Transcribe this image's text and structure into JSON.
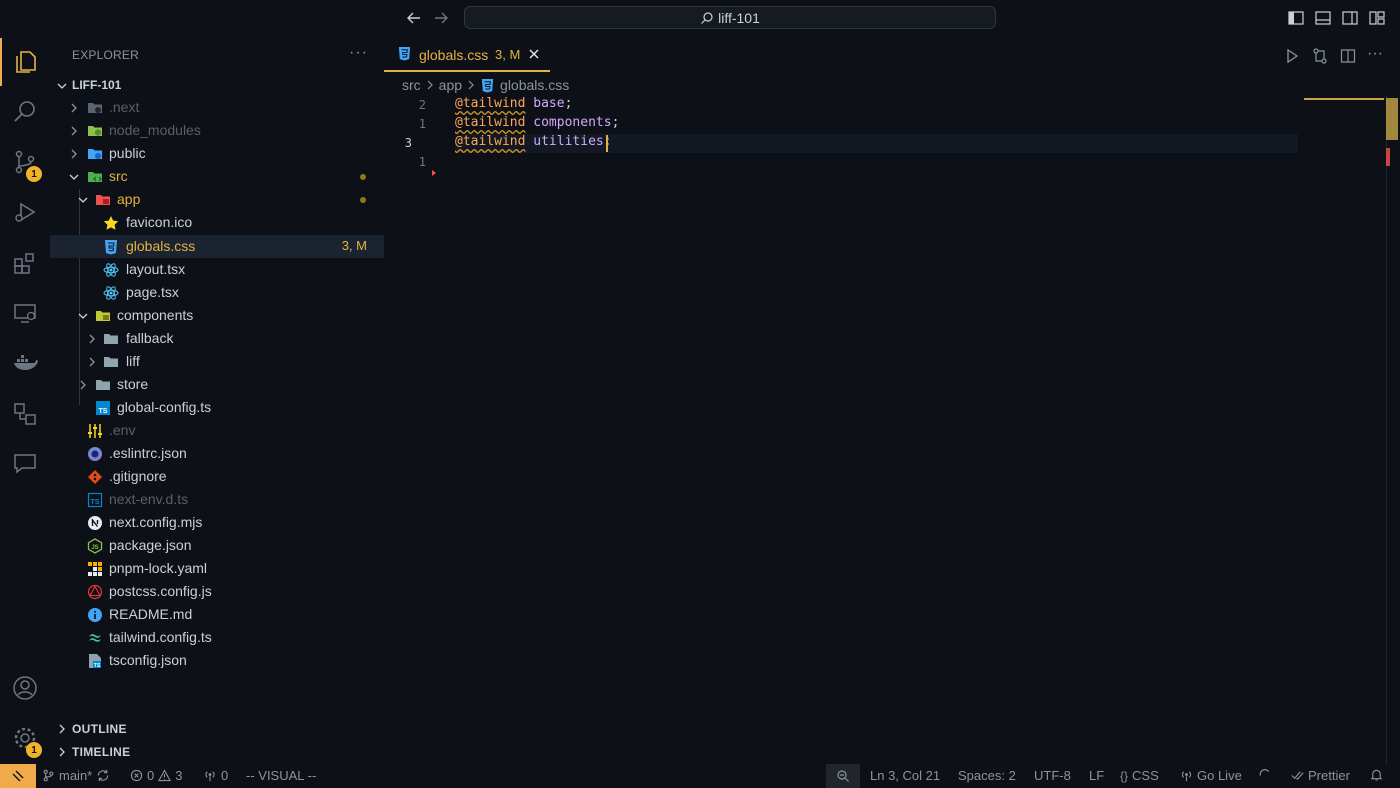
{
  "window": {
    "search_text": "liff-101"
  },
  "activity_bar": {
    "items": [
      "explorer",
      "search",
      "source-control",
      "run-and-debug",
      "extensions",
      "remote-explorer",
      "docker",
      "database",
      "chat"
    ],
    "source_control_badge": "1",
    "settings_badge": "1"
  },
  "sidebar": {
    "header": "EXPLORER",
    "root": "LIFF-101",
    "tree": [
      {
        "name": ".next",
        "badge": ""
      },
      {
        "name": "node_modules",
        "badge": ""
      },
      {
        "name": "public",
        "badge": ""
      },
      {
        "name": "src",
        "badge": ""
      },
      {
        "name": "app",
        "badge": ""
      },
      {
        "name": "favicon.ico",
        "badge": ""
      },
      {
        "name": "globals.css",
        "badge": "3, M"
      },
      {
        "name": "layout.tsx",
        "badge": ""
      },
      {
        "name": "page.tsx",
        "badge": ""
      },
      {
        "name": "components",
        "badge": ""
      },
      {
        "name": "fallback",
        "badge": ""
      },
      {
        "name": "liff",
        "badge": ""
      },
      {
        "name": "store",
        "badge": ""
      },
      {
        "name": "global-config.ts",
        "badge": ""
      },
      {
        "name": ".env",
        "badge": ""
      },
      {
        "name": ".eslintrc.json",
        "badge": ""
      },
      {
        "name": ".gitignore",
        "badge": ""
      },
      {
        "name": "next-env.d.ts",
        "badge": ""
      },
      {
        "name": "next.config.mjs",
        "badge": ""
      },
      {
        "name": "package.json",
        "badge": ""
      },
      {
        "name": "pnpm-lock.yaml",
        "badge": ""
      },
      {
        "name": "postcss.config.js",
        "badge": ""
      },
      {
        "name": "README.md",
        "badge": ""
      },
      {
        "name": "tailwind.config.ts",
        "badge": ""
      },
      {
        "name": "tsconfig.json",
        "badge": ""
      }
    ],
    "outline": "OUTLINE",
    "timeline": "TIMELINE"
  },
  "editor": {
    "tab": {
      "label": "globals.css",
      "badge": "3, M"
    },
    "breadcrumbs": [
      "src",
      "app",
      "globals.css"
    ],
    "lines": [
      {
        "number": "2",
        "directive": "@tailwind",
        "arg": "base",
        "end": ";"
      },
      {
        "number": "1",
        "directive": "@tailwind",
        "arg": "components",
        "end": ";"
      },
      {
        "number": "3",
        "directive": "@tailwind",
        "arg": "utilities",
        "end": ";"
      },
      {
        "number": "1",
        "directive": "",
        "arg": "",
        "end": ""
      }
    ]
  },
  "status_bar": {
    "branch": "main*",
    "errors": "0",
    "warnings": "3",
    "ports": "0",
    "mode": "-- VISUAL --",
    "position": "Ln 3, Col 21",
    "spaces": "Spaces: 2",
    "encoding": "UTF-8",
    "eol": "LF",
    "language": "CSS",
    "golive": "Go Live",
    "prettier": "Prettier"
  },
  "colors": {
    "background": "#0d1117",
    "accent": "#f0a94b",
    "modified": "#e3b341",
    "directive": "#ffa657",
    "keyword": "#d2a8ff"
  }
}
